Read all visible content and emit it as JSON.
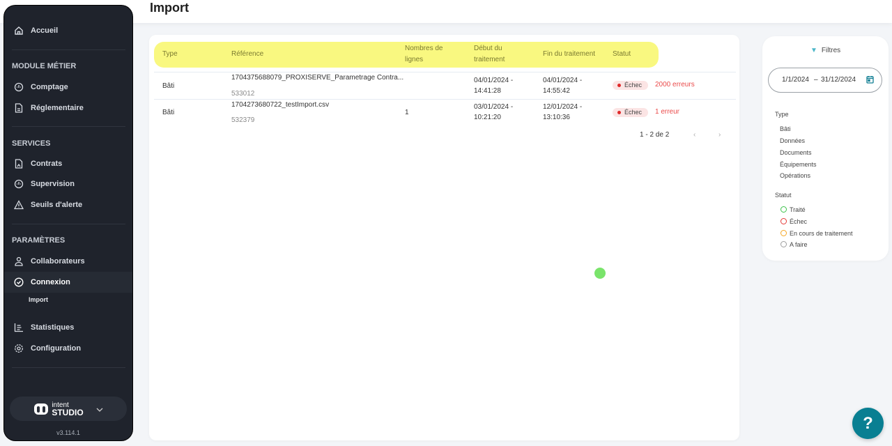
{
  "header": {
    "title": "Import"
  },
  "sidebar": {
    "home": "Accueil",
    "sections": [
      {
        "title": "MODULE MÉTIER",
        "items": [
          "Comptage",
          "Réglementaire"
        ]
      },
      {
        "title": "SERVICES",
        "items": [
          "Contrats",
          "Supervision",
          "Seuils d'alerte"
        ]
      },
      {
        "title": "PARAMÈTRES",
        "items": [
          "Collaborateurs",
          "Connexion"
        ]
      }
    ],
    "sub_item": "Import",
    "bottom_items": [
      "Statistiques",
      "Configuration"
    ],
    "brand_top": "intent",
    "brand_bottom": "STUDIO",
    "version": "v3.114.1"
  },
  "table": {
    "headers": [
      "Type",
      "Référence",
      "Nombres de lignes",
      "Début du traitement",
      "Fin du traitement",
      "Statut"
    ],
    "rows": [
      {
        "type": "Bâti",
        "ref": "1704375688079_PROXISERVE_Parametrage Contra...",
        "id": "533012",
        "lines": "",
        "start": "04/01/2024 -",
        "start_time": "14:41:28",
        "end": "04/01/2024 -",
        "end_time": "14:55:42",
        "status": "Échec",
        "errors": "2000 erreurs"
      },
      {
        "type": "Bâti",
        "ref": "1704273680722_testImport.csv",
        "id": "532379",
        "lines": "1",
        "start": "03/01/2024 -",
        "start_time": "10:21:20",
        "end": "12/01/2024 -",
        "end_time": "13:10:36",
        "status": "Échec",
        "errors": "1 erreur"
      }
    ],
    "pagination": "1 - 2 de 2"
  },
  "filters": {
    "title": "Filtres",
    "date_start": "1/1/2024",
    "date_sep": "–",
    "date_end": "31/12/2024",
    "type_label": "Type",
    "types": [
      "Bâti",
      "Données",
      "Documents",
      "Équipements",
      "Opérations"
    ],
    "status_label": "Statut",
    "statuses": [
      {
        "label": "Traité",
        "color": "#3cc24a"
      },
      {
        "label": "Échec",
        "color": "#e53935"
      },
      {
        "label": "En cours de traitement",
        "color": "#f5a623"
      },
      {
        "label": "A faire",
        "color": "#9e9e9e"
      }
    ]
  },
  "help": "?"
}
